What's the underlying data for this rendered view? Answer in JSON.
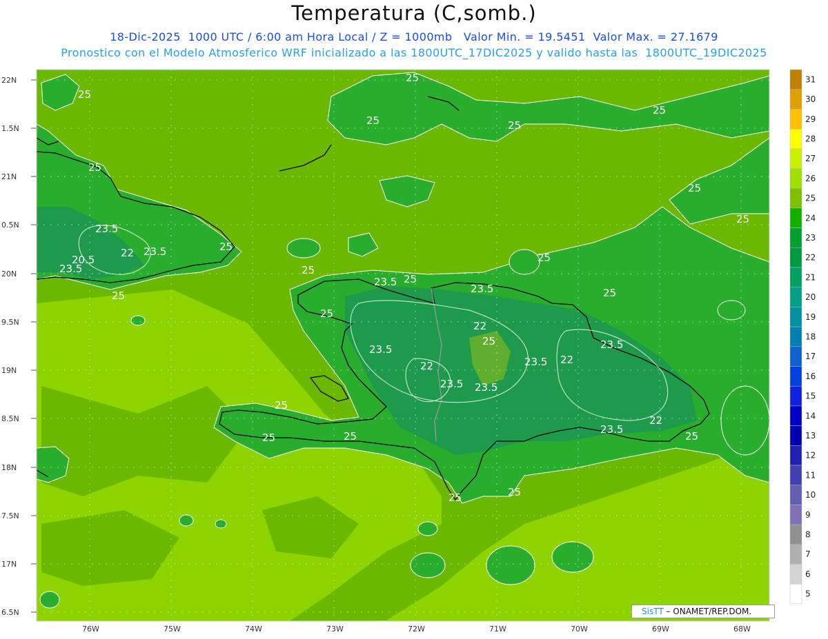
{
  "header": {
    "title": "Temperatura (C,somb.)",
    "line1": "18-Dic-2025  1000 UTC / 6:00 am Hora Local / Z = 1000mb   Valor Min. = 19.5451  Valor Max. = 27.1679",
    "line2": "Pronostico con el Modelo Atmosferico WRF inicializado a las 1800UTC_17DIC2025 y valido hasta las  1800UTC_19DIC2025"
  },
  "axes": {
    "lat_labels": [
      "22N",
      "1.5N",
      "21N",
      "0.5N",
      "20N",
      "9.5N",
      "19N",
      "8.5N",
      "18N",
      "7.5N",
      "17N",
      "6.5N"
    ],
    "lon_labels": [
      "76W",
      "75W",
      "74W",
      "73W",
      "72W",
      "71W",
      "70W",
      "69W",
      "68W"
    ]
  },
  "contour_labels": [
    "25",
    "23.5",
    "22",
    "20.5"
  ],
  "colorbar": {
    "levels": [
      "31",
      "30",
      "29",
      "28",
      "27",
      "26",
      "25",
      "24",
      "23",
      "22",
      "21",
      "20",
      "19",
      "18",
      "17",
      "16",
      "15",
      "14",
      "13",
      "12",
      "11",
      "10",
      "9",
      "8",
      "7",
      "6",
      "5"
    ],
    "colors": [
      "#c08000",
      "#e0a000",
      "#ffc000",
      "#ffff00",
      "#c8f000",
      "#a0e000",
      "#7cc000",
      "#10b000",
      "#00a030",
      "#009a40",
      "#00a060",
      "#00a088",
      "#0090a0",
      "#0080b0",
      "#1060d0",
      "#0040e0",
      "#1020e0",
      "#0000c8",
      "#0000b0",
      "#2020b0",
      "#4040b0",
      "#6060b0",
      "#8070b8",
      "#909090",
      "#b0b0b0",
      "#d4d4d4",
      "#ffffff"
    ]
  },
  "credit": {
    "brand": "SisTT",
    "text": "– ONAMET/REP.DOM."
  },
  "colors": {
    "sea_warm": "#8ed400",
    "sea_mid": "#6ab800",
    "land_cool": "#28ad2c",
    "land_cold": "#1e9a4c"
  }
}
